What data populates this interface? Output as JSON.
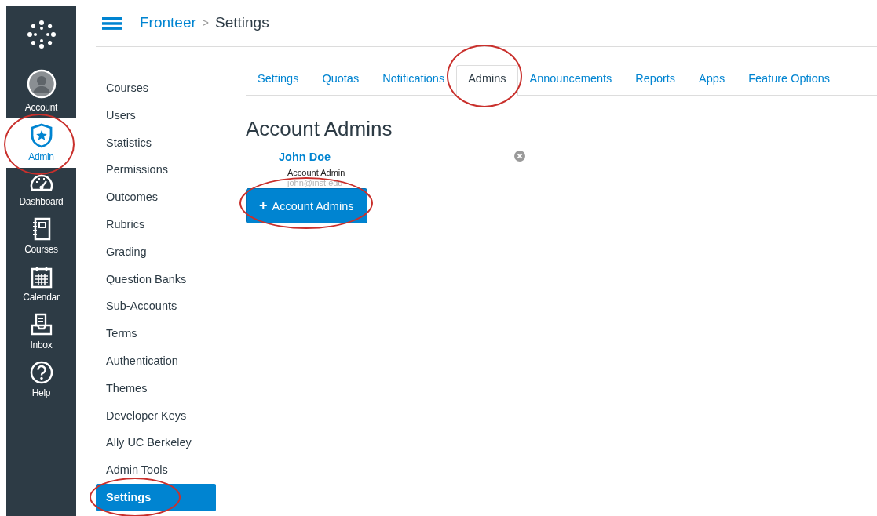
{
  "global_nav": [
    {
      "label": "Account",
      "kind": "avatar",
      "selected": false,
      "circled": false
    },
    {
      "label": "Admin",
      "kind": "shield",
      "selected": true,
      "circled": true
    },
    {
      "label": "Dashboard",
      "kind": "gauge",
      "selected": false,
      "circled": false
    },
    {
      "label": "Courses",
      "kind": "book",
      "selected": false,
      "circled": false
    },
    {
      "label": "Calendar",
      "kind": "calendar",
      "selected": false,
      "circled": false
    },
    {
      "label": "Inbox",
      "kind": "inbox",
      "selected": false,
      "circled": false
    },
    {
      "label": "Help",
      "kind": "help",
      "selected": false,
      "circled": false
    }
  ],
  "breadcrumb": [
    "Fronteer",
    "Settings"
  ],
  "breadcrumb_separator": ">",
  "account_nav": [
    {
      "label": "Courses",
      "selected": false,
      "circled": false
    },
    {
      "label": "Users",
      "selected": false,
      "circled": false
    },
    {
      "label": "Statistics",
      "selected": false,
      "circled": false
    },
    {
      "label": "Permissions",
      "selected": false,
      "circled": false
    },
    {
      "label": "Outcomes",
      "selected": false,
      "circled": false
    },
    {
      "label": "Rubrics",
      "selected": false,
      "circled": false
    },
    {
      "label": "Grading",
      "selected": false,
      "circled": false
    },
    {
      "label": "Question Banks",
      "selected": false,
      "circled": false
    },
    {
      "label": "Sub-Accounts",
      "selected": false,
      "circled": false
    },
    {
      "label": "Terms",
      "selected": false,
      "circled": false
    },
    {
      "label": "Authentication",
      "selected": false,
      "circled": false
    },
    {
      "label": "Themes",
      "selected": false,
      "circled": false
    },
    {
      "label": "Developer Keys",
      "selected": false,
      "circled": false
    },
    {
      "label": "Ally UC Berkeley",
      "selected": false,
      "circled": false
    },
    {
      "label": "Admin Tools",
      "selected": false,
      "circled": false
    },
    {
      "label": "Settings",
      "selected": true,
      "circled": true
    }
  ],
  "tabs": [
    {
      "label": "Settings",
      "selected": false,
      "circled": false
    },
    {
      "label": "Quotas",
      "selected": false,
      "circled": false
    },
    {
      "label": "Notifications",
      "selected": false,
      "circled": false
    },
    {
      "label": "Admins",
      "selected": true,
      "circled": true
    },
    {
      "label": "Announcements",
      "selected": false,
      "circled": false
    },
    {
      "label": "Reports",
      "selected": false,
      "circled": false
    },
    {
      "label": "Apps",
      "selected": false,
      "circled": false
    },
    {
      "label": "Feature Options",
      "selected": false,
      "circled": false
    }
  ],
  "heading": "Account Admins",
  "admins": [
    {
      "name": "John Doe",
      "role": "Account Admin",
      "email": "john@inst.edu"
    }
  ],
  "add_button": {
    "icon": "+",
    "label": "Account Admins",
    "circled": true
  }
}
